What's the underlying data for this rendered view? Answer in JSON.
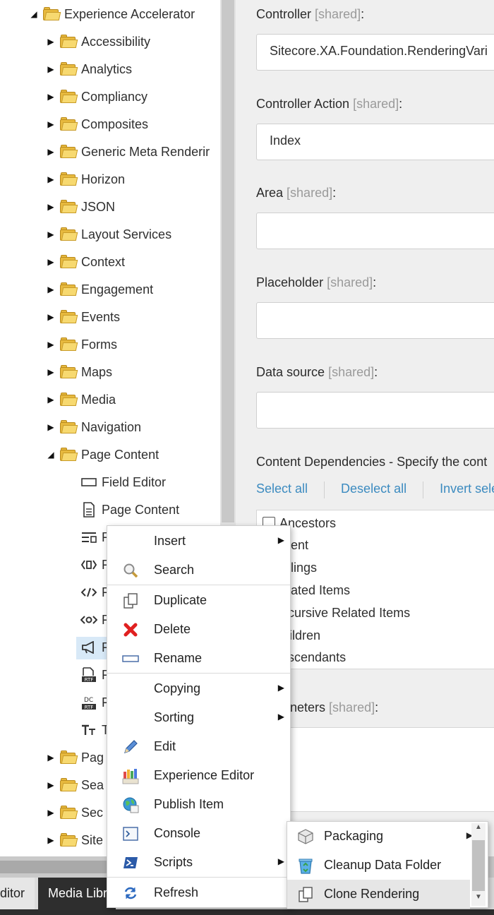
{
  "tree": {
    "root": {
      "label": "Experience Accelerator"
    },
    "folders": [
      {
        "label": "Accessibility"
      },
      {
        "label": "Analytics"
      },
      {
        "label": "Compliancy"
      },
      {
        "label": "Composites"
      },
      {
        "label": "Generic Meta Renderir"
      },
      {
        "label": "Horizon"
      },
      {
        "label": "JSON"
      },
      {
        "label": "Layout Services"
      },
      {
        "label": "Context"
      },
      {
        "label": "Engagement"
      },
      {
        "label": "Events"
      },
      {
        "label": "Forms"
      },
      {
        "label": "Maps"
      },
      {
        "label": "Media"
      },
      {
        "label": "Navigation"
      },
      {
        "label": "Page Content"
      }
    ],
    "page_content_children": [
      {
        "label": "Field Editor"
      },
      {
        "label": "Page Content"
      },
      {
        "label": "F"
      },
      {
        "label": "F"
      },
      {
        "label": "F"
      },
      {
        "label": "F"
      },
      {
        "label": "F"
      },
      {
        "label": "F"
      },
      {
        "label": "F"
      },
      {
        "label": "T"
      }
    ],
    "after_folders": [
      {
        "label": "Pag"
      },
      {
        "label": "Sea"
      },
      {
        "label": "Sec"
      },
      {
        "label": "Site"
      }
    ]
  },
  "fields": {
    "shared_tag": "[shared]",
    "controller": {
      "label": "Controller",
      "value": "Sitecore.XA.Foundation.RenderingVari"
    },
    "controller_action": {
      "label": "Controller Action",
      "value": "Index"
    },
    "area": {
      "label": "Area",
      "value": ""
    },
    "placeholder": {
      "label": "Placeholder",
      "value": ""
    },
    "data_source": {
      "label": "Data source",
      "value": ""
    },
    "content_dependencies": {
      "label": "Content Dependencies - Specify the cont"
    },
    "parameters": {
      "label": "neters"
    }
  },
  "links": {
    "select_all": "Select all",
    "deselect_all": "Deselect all",
    "invert": "Invert sele"
  },
  "checklist": [
    "Ancestors",
    "arent",
    "blings",
    "elated Items",
    "ecursive Related Items",
    "hildren",
    "escendants"
  ],
  "context_menu": {
    "insert": "Insert",
    "search": "Search",
    "duplicate": "Duplicate",
    "delete": "Delete",
    "rename": "Rename",
    "copying": "Copying",
    "sorting": "Sorting",
    "edit": "Edit",
    "experience_editor": "Experience Editor",
    "publish_item": "Publish Item",
    "console": "Console",
    "scripts": "Scripts",
    "refresh": "Refresh"
  },
  "scripts_submenu": {
    "packaging": "Packaging",
    "cleanup": "Cleanup Data Folder",
    "clone": "Clone Rendering"
  },
  "taskbar": {
    "editor": "ditor",
    "media": "Media Libr"
  },
  "colors": {
    "link": "#3c8bc0",
    "selection": "#d8e9f7",
    "delete_red": "#e02020",
    "taskbar_dark": "#2e2e2e"
  }
}
